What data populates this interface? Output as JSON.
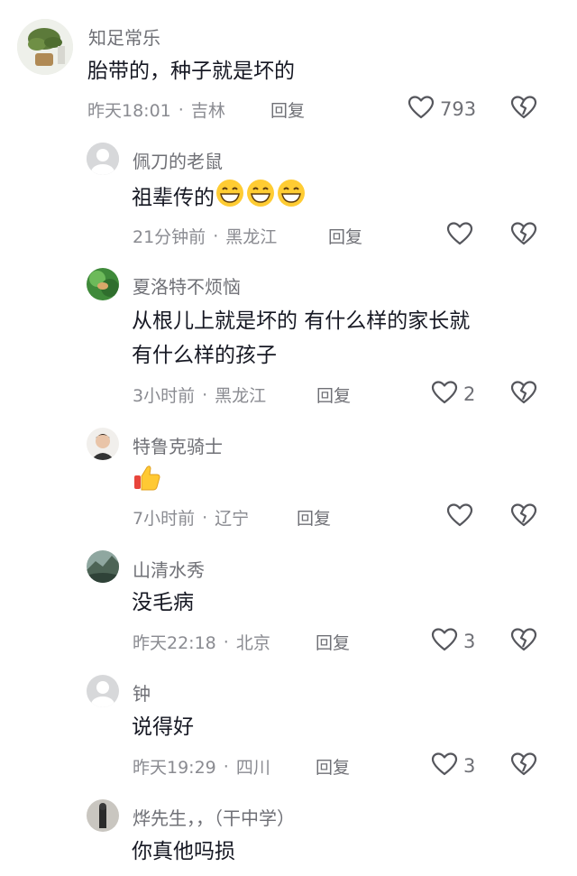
{
  "comments": [
    {
      "name": "知足常乐",
      "text": "胎带的，种子就是坏的",
      "time": "昨天18:01",
      "location": "吉林",
      "reply": "回复",
      "likes": "793"
    },
    {
      "name": "佩刀的老鼠",
      "text": "祖辈传的",
      "emoji": [
        "grin-emoji",
        "grin-emoji",
        "grin-emoji"
      ],
      "time": "21分钟前",
      "location": "黑龙江",
      "reply": "回复",
      "likes": ""
    },
    {
      "name": "夏洛特不烦恼",
      "text_lines": [
        "从根儿上就是坏的 有什么样的家长就",
        "有什么样的孩子"
      ],
      "time": "3小时前",
      "location": "黑龙江",
      "reply": "回复",
      "likes": "2"
    },
    {
      "name": "特鲁克骑士",
      "emoji": [
        "thumbs-up-emoji"
      ],
      "time": "7小时前",
      "location": "辽宁",
      "reply": "回复",
      "likes": ""
    },
    {
      "name": "山清水秀",
      "text": "没毛病",
      "time": "昨天22:18",
      "location": "北京",
      "reply": "回复",
      "likes": "3"
    },
    {
      "name": "钟",
      "text": "说得好",
      "time": "昨天19:29",
      "location": "四川",
      "reply": "回复",
      "likes": "3"
    },
    {
      "name": "烨先生，，（干中学）",
      "text": "你真他吗损"
    }
  ],
  "separator": "·",
  "icons": {
    "like": "heart-icon",
    "dislike": "broken-heart-icon"
  }
}
